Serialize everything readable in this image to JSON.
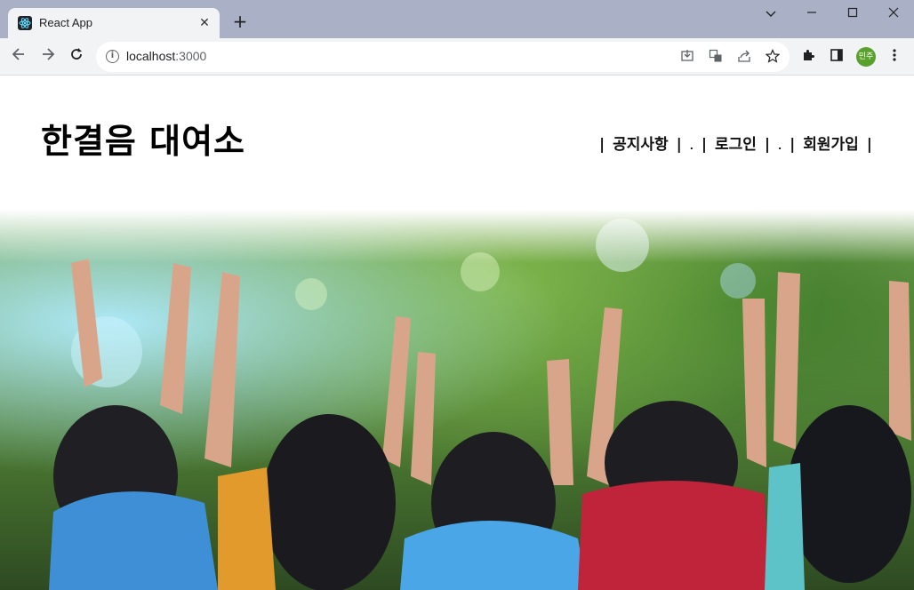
{
  "browser": {
    "tab_title": "React App",
    "new_tab": "+",
    "url_host": "localhost",
    "url_port": ":3000",
    "profile_label": "민주",
    "window_controls": [
      "chevron-down",
      "minimize",
      "maximize",
      "close"
    ]
  },
  "site": {
    "title": "한결음 대여소",
    "nav": {
      "notice": "공지사항",
      "login": "로그인",
      "signup": "회원가입",
      "bar": "|",
      "dot": "."
    }
  },
  "hero": {
    "image": "children-raising-hands-photo"
  }
}
